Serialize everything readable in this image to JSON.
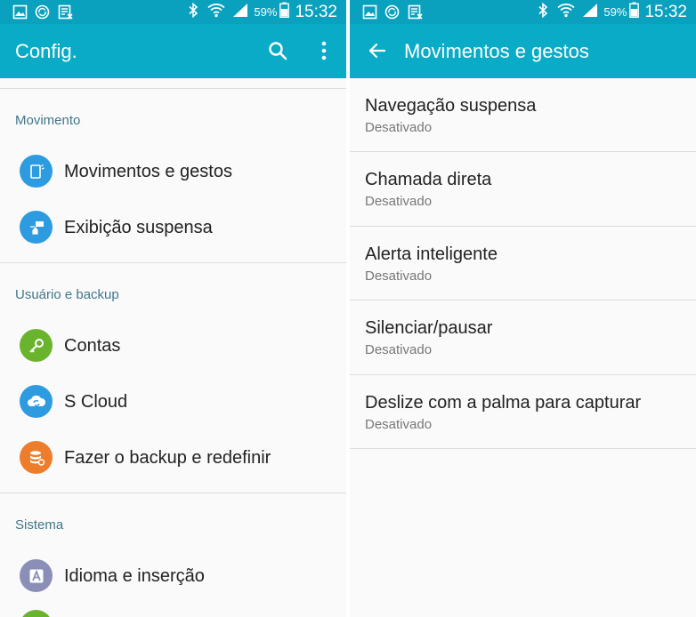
{
  "status_bar": {
    "battery_percent": "59%",
    "time": "15:32",
    "left_icons": [
      "gallery-icon",
      "sync-icon",
      "sheet-icon"
    ],
    "right_icons": [
      "bluetooth-icon",
      "wifi-icon",
      "signal-icon",
      "battery-icon"
    ]
  },
  "left": {
    "appbar": {
      "title": "Config.",
      "search_icon": "search-icon",
      "more_icon": "more-vert-icon"
    },
    "sections": [
      {
        "header": "Movimento",
        "items": [
          {
            "label": "Movimentos e gestos",
            "icon": "motion-icon",
            "color": "#2d9be0"
          },
          {
            "label": "Exibição suspensa",
            "icon": "air-view-icon",
            "color": "#2d9be0"
          }
        ]
      },
      {
        "header": "Usuário e backup",
        "items": [
          {
            "label": "Contas",
            "icon": "key-icon",
            "color": "#6ab42d"
          },
          {
            "label": "S Cloud",
            "icon": "cloud-icon",
            "color": "#2d9be0"
          },
          {
            "label": "Fazer o backup e redefinir",
            "icon": "backup-icon",
            "color": "#ee7d2b"
          }
        ]
      },
      {
        "header": "Sistema",
        "items": [
          {
            "label": "Idioma e inserção",
            "icon": "language-icon",
            "color": "#8b8fb8"
          }
        ]
      }
    ]
  },
  "right": {
    "appbar": {
      "title": "Movimentos e gestos",
      "back_icon": "back-arrow-icon"
    },
    "items": [
      {
        "title": "Navegação suspensa",
        "summary": "Desativado"
      },
      {
        "title": "Chamada direta",
        "summary": "Desativado"
      },
      {
        "title": "Alerta inteligente",
        "summary": "Desativado"
      },
      {
        "title": "Silenciar/pausar",
        "summary": "Desativado"
      },
      {
        "title": "Deslize com a palma para capturar",
        "summary": "Desativado"
      }
    ]
  },
  "colors": {
    "statusbar": "#0aa1be",
    "appbar": "#0aabc7",
    "section_header": "#41768a",
    "background": "#fafafa"
  }
}
